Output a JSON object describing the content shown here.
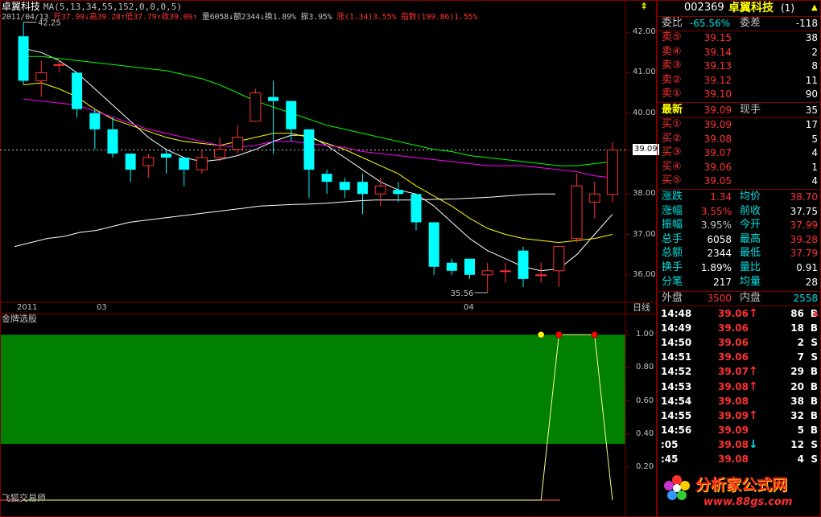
{
  "header": {
    "stock_name": "卓翼科技",
    "ma_label": "MA(5,13,34,55,152,0,0,0,5)",
    "date": "2011/04/13",
    "open_label": "开",
    "open": "37.99",
    "high_label": "高",
    "high": "39.28",
    "low_label": "低",
    "low": "37.79",
    "close_label": "收",
    "close": "39.09",
    "volume_label": "量",
    "volume": "6058",
    "amount_label": "额",
    "amount": "2344",
    "turnover_label": "换",
    "turnover": "1.89%",
    "amplitude_label": "振",
    "amplitude": "3.95%",
    "rise_label": "涨",
    "rise": "(1.34)3.55%",
    "index_label": "指数",
    "index": "(199.86)1.55%"
  },
  "colors": {
    "up": "#ff3232",
    "down": "#00ffff",
    "ma5": "#ffffff",
    "ma13": "#ffff00",
    "ma34": "#ff00ff",
    "ma55": "#00ff00",
    "ma152": "#ffffff",
    "panel_green": "#008000",
    "frame": "#800000"
  },
  "price_axis": {
    "ticks": [
      "42.00",
      "41.00",
      "40.00",
      "39.09",
      "38.00",
      "37.00",
      "36.00"
    ]
  },
  "time_axis": {
    "labels": [
      "2011",
      "03",
      "04"
    ],
    "period_button": "日线"
  },
  "annotations": {
    "max_label": "42.25",
    "min_label": "35.56"
  },
  "chart_data": {
    "type": "candlestick",
    "ylim": [
      35.4,
      42.4
    ],
    "candles": [
      [
        41.9,
        40.8,
        42.25,
        40.7
      ],
      [
        40.8,
        41.0,
        41.3,
        40.4
      ],
      [
        41.2,
        41.2,
        41.3,
        41.0
      ],
      [
        41.0,
        40.1,
        41.0,
        39.9
      ],
      [
        40.0,
        39.6,
        40.1,
        39.1
      ],
      [
        39.6,
        39.0,
        39.9,
        38.9
      ],
      [
        39.0,
        38.6,
        39.0,
        38.3
      ],
      [
        38.7,
        38.9,
        39.0,
        38.4
      ],
      [
        39.0,
        38.9,
        39.1,
        38.5
      ],
      [
        38.9,
        38.6,
        38.9,
        38.2
      ],
      [
        38.6,
        38.9,
        39.1,
        38.5
      ],
      [
        38.9,
        39.1,
        39.4,
        38.8
      ],
      [
        39.1,
        39.4,
        39.7,
        39.0
      ],
      [
        39.8,
        40.5,
        40.6,
        39.8
      ],
      [
        40.4,
        40.3,
        40.8,
        39.0
      ],
      [
        40.3,
        39.6,
        40.3,
        39.3
      ],
      [
        39.6,
        38.6,
        39.6,
        37.9
      ],
      [
        38.5,
        38.3,
        38.6,
        38.0
      ],
      [
        38.3,
        38.1,
        38.4,
        37.9
      ],
      [
        38.3,
        38.0,
        38.5,
        37.5
      ],
      [
        38.0,
        38.2,
        38.4,
        37.7
      ],
      [
        38.1,
        38.0,
        38.3,
        37.8
      ],
      [
        38.0,
        37.3,
        38.0,
        37.1
      ],
      [
        37.3,
        36.2,
        37.3,
        36.0
      ],
      [
        36.3,
        36.1,
        36.4,
        36.0
      ],
      [
        36.4,
        36.0,
        36.4,
        35.9
      ],
      [
        36.0,
        36.1,
        36.3,
        35.56
      ],
      [
        36.1,
        36.1,
        36.3,
        35.8
      ],
      [
        36.6,
        35.9,
        36.7,
        35.7
      ],
      [
        36.0,
        36.0,
        36.3,
        35.8
      ],
      [
        36.1,
        36.7,
        36.7,
        35.7
      ],
      [
        36.9,
        38.2,
        38.5,
        36.8
      ],
      [
        37.8,
        38.0,
        38.3,
        37.4
      ],
      [
        37.99,
        39.09,
        39.28,
        37.79
      ]
    ],
    "current_price": 39.09,
    "ma_series": [
      {
        "values": [
          41.6,
          41.5,
          41.3,
          41.0,
          40.6,
          40.2,
          39.8,
          39.4,
          39.1,
          38.9,
          38.8,
          38.85,
          38.95,
          39.1,
          39.3,
          39.45,
          39.45,
          39.2,
          38.9,
          38.6,
          38.3,
          38.1,
          38.0,
          37.7,
          37.3,
          36.9,
          36.6,
          36.4,
          36.2,
          36.1,
          36.15,
          36.5,
          37.0,
          37.5
        ]
      },
      {
        "values": [
          40.7,
          40.75,
          40.6,
          40.4,
          40.1,
          39.85,
          39.7,
          39.55,
          39.4,
          39.3,
          39.25,
          39.2,
          39.3,
          39.4,
          39.5,
          39.5,
          39.4,
          39.25,
          39.1,
          38.9,
          38.7,
          38.5,
          38.2,
          37.95,
          37.7,
          37.4,
          37.15,
          37.0,
          36.9,
          36.85,
          36.8,
          36.85,
          36.9,
          37.0
        ]
      },
      {
        "values": [
          40.35,
          40.3,
          40.25,
          40.2,
          40.05,
          39.9,
          39.75,
          39.6,
          39.5,
          39.4,
          39.3,
          39.2,
          39.15,
          39.2,
          39.3,
          39.3,
          39.25,
          39.2,
          39.15,
          39.05,
          39.0,
          38.95,
          38.9,
          38.85,
          38.8,
          38.75,
          38.7,
          38.7,
          38.7,
          38.65,
          38.6,
          38.55,
          38.45,
          38.4
        ]
      },
      {
        "values": [
          41.4,
          41.4,
          41.35,
          41.3,
          41.25,
          41.2,
          41.15,
          41.1,
          41.05,
          40.95,
          40.85,
          40.7,
          40.5,
          40.3,
          40.15,
          40.0,
          39.85,
          39.7,
          39.6,
          39.5,
          39.4,
          39.3,
          39.2,
          39.1,
          39.05,
          38.95,
          38.9,
          38.85,
          38.8,
          38.75,
          38.7,
          38.7,
          38.75,
          38.8
        ]
      },
      {
        "values": [
          36.7,
          36.8,
          36.9,
          36.95,
          37.05,
          37.1,
          37.2,
          37.3,
          37.35,
          37.4,
          37.45,
          37.5,
          37.55,
          37.6,
          37.65,
          37.7,
          37.72,
          37.74,
          37.75,
          37.77,
          37.8,
          37.83,
          37.85,
          37.85,
          37.85,
          37.86,
          37.87,
          37.88,
          37.9,
          37.92,
          37.95,
          37.98,
          38.0,
          38.0
        ]
      }
    ],
    "indicator": {
      "title": "金牌选股",
      "ticks": [
        "1.00",
        "0.80",
        "0.60",
        "0.40",
        "0.20"
      ],
      "ylim": [
        0,
        1.05
      ],
      "shaded_range": [
        0.34,
        1.0
      ],
      "line": [
        0,
        0,
        0,
        0,
        0,
        0,
        0,
        0,
        0,
        0,
        0,
        0,
        0,
        0,
        0,
        0,
        0,
        0,
        0,
        0,
        0,
        0,
        0,
        0,
        0,
        0,
        0,
        0,
        0,
        0,
        1,
        1,
        1,
        0
      ],
      "dots": [
        {
          "index": 29,
          "color": "#ffff00"
        },
        {
          "index": 30,
          "color": "#ff0000"
        },
        {
          "index": 32,
          "color": "#ff0000"
        }
      ]
    }
  },
  "quote_panel": {
    "code": "002369",
    "name": "卓翼科技",
    "tag": "(1)",
    "weibi_label": "委比",
    "weibi": "-65.56%",
    "weicha_label": "委差",
    "weicha": "-118",
    "asks": [
      {
        "label": "卖⑤",
        "price": "39.15",
        "vol": "38"
      },
      {
        "label": "卖④",
        "price": "39.14",
        "vol": "2"
      },
      {
        "label": "卖③",
        "price": "39.13",
        "vol": "8"
      },
      {
        "label": "卖②",
        "price": "39.12",
        "vol": "11"
      },
      {
        "label": "卖①",
        "price": "39.10",
        "vol": "90"
      }
    ],
    "latest_label": "最新",
    "latest": "39.09",
    "xianshou_label": "现手",
    "xianshou": "35",
    "bids": [
      {
        "label": "买①",
        "price": "39.09",
        "vol": "17"
      },
      {
        "label": "买②",
        "price": "39.08",
        "vol": "5"
      },
      {
        "label": "买③",
        "price": "39.07",
        "vol": "4"
      },
      {
        "label": "买④",
        "price": "39.06",
        "vol": "1"
      },
      {
        "label": "买⑤",
        "price": "39.05",
        "vol": "4"
      }
    ],
    "stats": [
      {
        "l1": "涨跌",
        "v1": "1.34",
        "l2": "均价",
        "v2": "38.70"
      },
      {
        "l1": "涨幅",
        "v1": "3.55%",
        "l2": "前收",
        "v2": "37.75"
      },
      {
        "l1": "振幅",
        "v1": "3.95%",
        "l2": "今开",
        "v2": "37.99"
      },
      {
        "l1": "总手",
        "v1": "6058",
        "l2": "最高",
        "v2": "39.28"
      },
      {
        "l1": "总额",
        "v1": "2344",
        "l2": "最低",
        "v2": "37.79"
      },
      {
        "l1": "换手",
        "v1": "1.89%",
        "l2": "量比",
        "v2": "0.91"
      },
      {
        "l1": "分笔",
        "v1": "217",
        "l2": "均量",
        "v2": "28"
      }
    ],
    "waipan_label": "外盘",
    "waipan": "3500",
    "neipan_label": "内盘",
    "neipan": "2558",
    "ticks": [
      {
        "time": "14:48",
        "price": "39.06",
        "arrow": "up",
        "vol": "86",
        "side": "B"
      },
      {
        "time": "14:49",
        "price": "39.06",
        "arrow": "",
        "vol": "18",
        "side": "B"
      },
      {
        "time": "14:50",
        "price": "39.06",
        "arrow": "",
        "vol": "2",
        "side": "S"
      },
      {
        "time": "14:51",
        "price": "39.06",
        "arrow": "",
        "vol": "7",
        "side": "S"
      },
      {
        "time": "14:52",
        "price": "39.07",
        "arrow": "up",
        "vol": "29",
        "side": "B"
      },
      {
        "time": "14:53",
        "price": "39.08",
        "arrow": "up",
        "vol": "20",
        "side": "B"
      },
      {
        "time": "14:54",
        "price": "39.08",
        "arrow": "",
        "vol": "38",
        "side": "B"
      },
      {
        "time": "14:55",
        "price": "39.09",
        "arrow": "up",
        "vol": "32",
        "side": "B"
      },
      {
        "time": "14:56",
        "price": "39.09",
        "arrow": "",
        "vol": "5",
        "side": "B"
      },
      {
        "time": ":05",
        "price": "39.08",
        "arrow": "down",
        "vol": "12",
        "side": "S"
      },
      {
        "time": ":45",
        "price": "39.08",
        "arrow": "",
        "vol": "4",
        "side": "S"
      }
    ]
  },
  "footer": {
    "author": "飞狐交易师",
    "watermark_text": "分析家公式网",
    "watermark_url": "www.88gs.com"
  }
}
